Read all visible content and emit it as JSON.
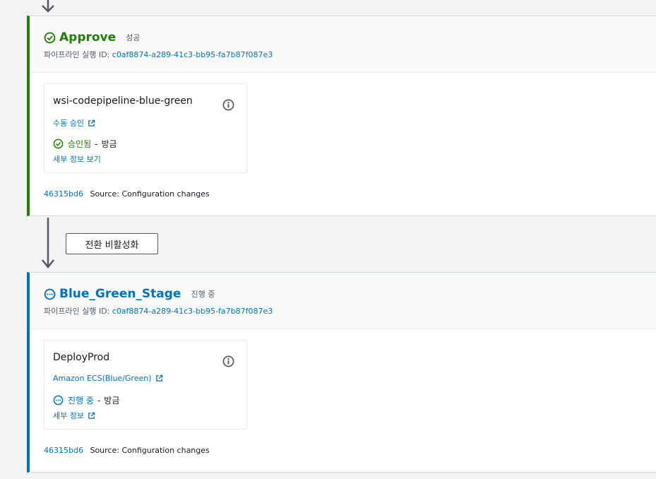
{
  "approve_stage": {
    "name": "Approve",
    "status": "성공",
    "exec_label": "파이프라인 실행 ID:",
    "exec_id": "c0af8874-a289-41c3-bb95-fa7b87f087e3",
    "action": {
      "name": "wsi-codepipeline-blue-green",
      "provider": "수동 승인",
      "status_word": "승인됨",
      "sep": "-",
      "time": "방금",
      "details": "세부 정보 보기"
    },
    "commit_id": "46315bd6",
    "commit_message": "Source: Configuration changes",
    "status_color": "#1d8102"
  },
  "transition": {
    "button_label": "전환 비활성화"
  },
  "bg_stage": {
    "name": "Blue_Green_Stage",
    "status": "진행 중",
    "exec_label": "파이프라인 실행 ID:",
    "exec_id": "c0af8874-a289-41c3-bb95-fa7b87f087e3",
    "action": {
      "name": "DeployProd",
      "provider": "Amazon ECS(Blue/Green)",
      "status_word": "진행 중",
      "sep": "-",
      "time": "방금",
      "details": "세부 정보"
    },
    "commit_id": "46315bd6",
    "commit_message": "Source: Configuration changes",
    "status_color": "#0073bb"
  },
  "icons": {
    "success": "check-circle-icon",
    "in_progress": "ellipsis-circle-icon",
    "info": "info-icon",
    "external": "external-link-icon",
    "arrow": "arrow-down-icon"
  }
}
